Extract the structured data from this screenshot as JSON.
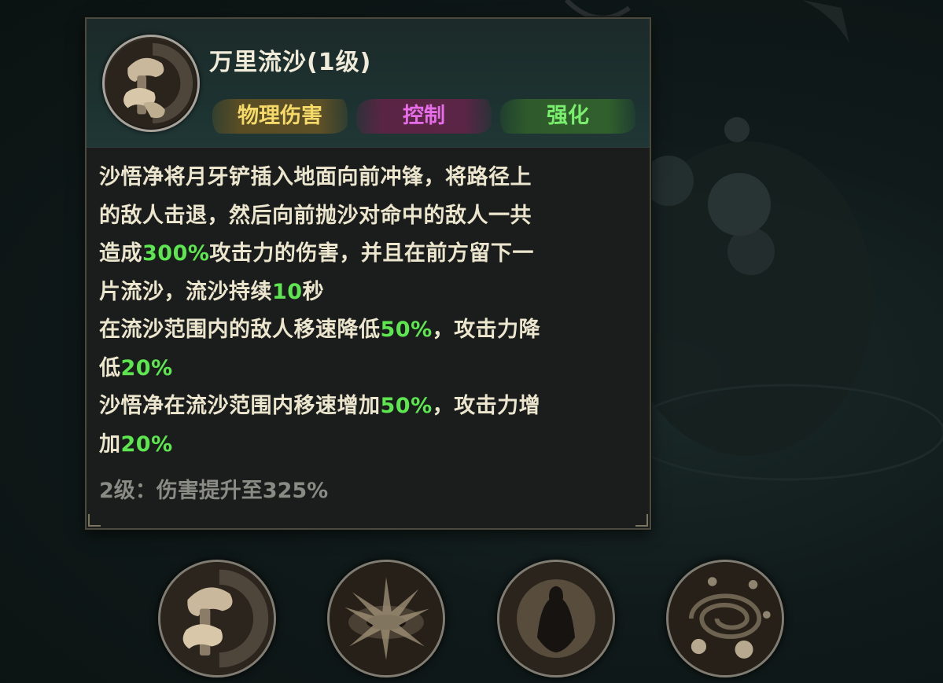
{
  "skill": {
    "title": "万里流沙(1级)",
    "icon": "sand-shovel-icon"
  },
  "tags": [
    {
      "label": "物理伤害",
      "color": "#f6da69"
    },
    {
      "label": "控制",
      "color": "#e56ee8"
    },
    {
      "label": "强化",
      "color": "#7aee6d"
    }
  ],
  "description": {
    "l1": "沙悟净将月牙铲插入地面向前冲锋，将路径上",
    "l2": "的敌人击退，然后向前抛沙对命中的敌人一共",
    "l3a": "造成",
    "l3b": "300%",
    "l3c": "攻击力的伤害，并且在前方留下一",
    "l4a": "片流沙，流沙持续",
    "l4b": "10",
    "l4c": "秒",
    "l5a": "在流沙范围内的敌人移速降低",
    "l5b": "50%",
    "l5c": "，攻击力降",
    "l6a": "低",
    "l6b": "20%",
    "l7a": "沙悟净在流沙范围内移速增加",
    "l7b": "50%",
    "l7c": "，攻击力增",
    "l8a": "加",
    "l8b": "20%"
  },
  "next_level": "2级：伤害提升至325%",
  "highlight_color": "#5de64f",
  "skill_slots": [
    {
      "icon": "sand-shovel-icon"
    },
    {
      "icon": "sand-burst-icon"
    },
    {
      "icon": "shadow-figure-icon"
    },
    {
      "icon": "skull-vortex-icon"
    }
  ]
}
